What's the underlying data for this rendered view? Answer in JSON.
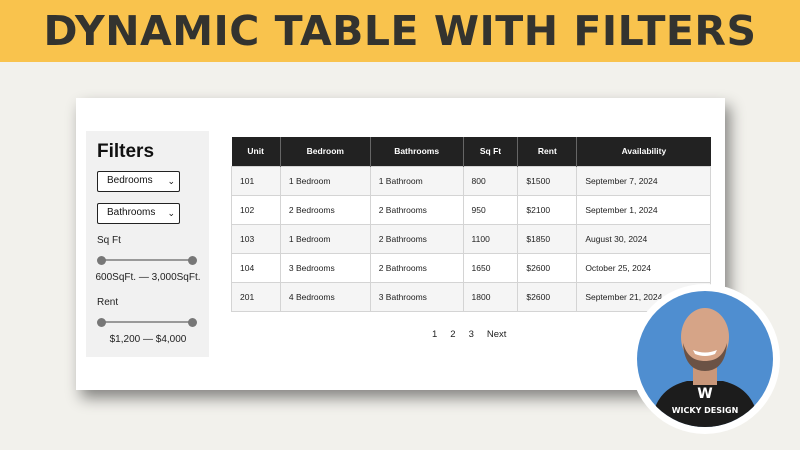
{
  "banner": {
    "title": "DYNAMIC TABLE WITH FILTERS"
  },
  "filters": {
    "title": "Filters",
    "bedrooms_select": "Bedrooms",
    "bathrooms_select": "Bathrooms",
    "sqft_label": "Sq Ft",
    "sqft_range": "600SqFt. — 3,000SqFt.",
    "rent_label": "Rent",
    "rent_range": "$1,200 — $4,000"
  },
  "table": {
    "headers": [
      "Unit",
      "Bedroom",
      "Bathrooms",
      "Sq Ft",
      "Rent",
      "Availability"
    ],
    "rows": [
      [
        "101",
        "1 Bedroom",
        "1 Bathroom",
        "800",
        "$1500",
        "September 7, 2024"
      ],
      [
        "102",
        "2 Bedrooms",
        "2 Bathrooms",
        "950",
        "$2100",
        "September 1, 2024"
      ],
      [
        "103",
        "1 Bedroom",
        "2 Bathrooms",
        "1100",
        "$1850",
        "August 30, 2024"
      ],
      [
        "104",
        "3 Bedrooms",
        "2 Bathrooms",
        "1650",
        "$2600",
        "October 25, 2024"
      ],
      [
        "201",
        "4 Bedrooms",
        "3 Bathrooms",
        "1800",
        "$2600",
        "September 21, 2024"
      ]
    ]
  },
  "pagination": {
    "pages": [
      "1",
      "2",
      "3"
    ],
    "next": "Next"
  },
  "presenter": {
    "shirt_text": "WICKY DESIGN",
    "shirt_logo": "W"
  },
  "colors": {
    "banner": "#f9c34d",
    "header_row": "#222222",
    "photo_bg": "#4f8ed0"
  }
}
